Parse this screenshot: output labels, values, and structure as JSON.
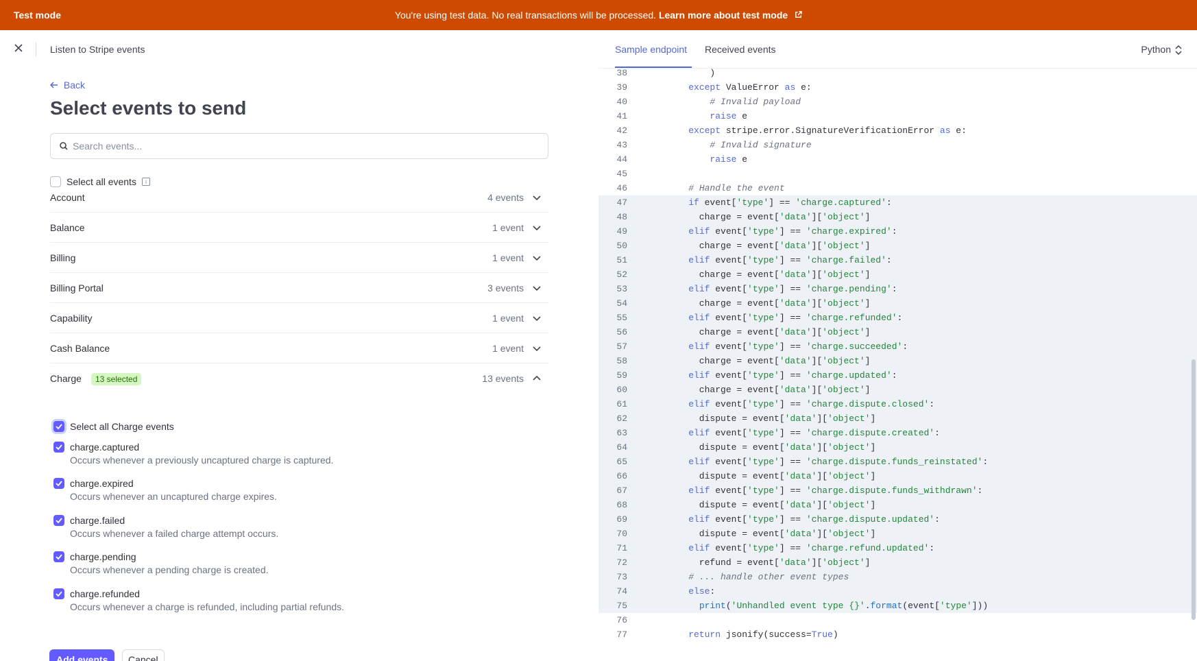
{
  "banner": {
    "mode": "Test mode",
    "message": "You're using test data. No real transactions will be processed.",
    "link": "Learn more about test mode"
  },
  "panel": {
    "title": "Listen to Stripe events",
    "back": "Back",
    "heading": "Select events to send",
    "search_placeholder": "Search events...",
    "select_all": "Select all events"
  },
  "categories": [
    {
      "name": "Account",
      "count": "4 events"
    },
    {
      "name": "Balance",
      "count": "1 event"
    },
    {
      "name": "Billing",
      "count": "1 event"
    },
    {
      "name": "Billing Portal",
      "count": "3 events"
    },
    {
      "name": "Capability",
      "count": "1 event"
    },
    {
      "name": "Cash Balance",
      "count": "1 event"
    },
    {
      "name": "Charge",
      "count": "13 events",
      "badge": "13 selected"
    }
  ],
  "charge": {
    "select_all": "Select all Charge events",
    "events": [
      {
        "name": "charge.captured",
        "desc": "Occurs whenever a previously uncaptured charge is captured."
      },
      {
        "name": "charge.expired",
        "desc": "Occurs whenever an uncaptured charge expires."
      },
      {
        "name": "charge.failed",
        "desc": "Occurs whenever a failed charge attempt occurs."
      },
      {
        "name": "charge.pending",
        "desc": "Occurs whenever a pending charge is created."
      },
      {
        "name": "charge.refunded",
        "desc": "Occurs whenever a charge is refunded, including partial refunds."
      }
    ]
  },
  "buttons": {
    "add": "Add events",
    "cancel": "Cancel"
  },
  "right": {
    "tabs": [
      "Sample endpoint",
      "Received events"
    ],
    "language": "Python"
  },
  "code": [
    {
      "n": "38",
      "t": [
        [
          "",
          "        )"
        ]
      ]
    },
    {
      "n": "39",
      "t": [
        [
          "",
          "    "
        ],
        [
          "kw",
          "except"
        ],
        [
          "",
          " ValueError "
        ],
        [
          "kw",
          "as"
        ],
        [
          "",
          " e:"
        ]
      ]
    },
    {
      "n": "40",
      "t": [
        [
          "",
          "        "
        ],
        [
          "cm",
          "# Invalid payload"
        ]
      ]
    },
    {
      "n": "41",
      "t": [
        [
          "",
          "        "
        ],
        [
          "kw",
          "raise"
        ],
        [
          "",
          " e"
        ]
      ]
    },
    {
      "n": "42",
      "t": [
        [
          "",
          "    "
        ],
        [
          "kw",
          "except"
        ],
        [
          "",
          " stripe.error.SignatureVerificationError "
        ],
        [
          "kw",
          "as"
        ],
        [
          "",
          " e:"
        ]
      ]
    },
    {
      "n": "43",
      "t": [
        [
          "",
          "        "
        ],
        [
          "cm",
          "# Invalid signature"
        ]
      ]
    },
    {
      "n": "44",
      "t": [
        [
          "",
          "        "
        ],
        [
          "kw",
          "raise"
        ],
        [
          "",
          " e"
        ]
      ]
    },
    {
      "n": "45",
      "t": [
        [
          "",
          ""
        ]
      ]
    },
    {
      "n": "46",
      "t": [
        [
          "",
          "    "
        ],
        [
          "cm",
          "# Handle the event"
        ]
      ]
    },
    {
      "n": "47",
      "t": [
        [
          "",
          "    "
        ],
        [
          "kw",
          "if"
        ],
        [
          "",
          " event["
        ],
        [
          "str",
          "'type'"
        ],
        [
          "",
          "] == "
        ],
        [
          "str",
          "'charge.captured'"
        ],
        [
          "",
          ":"
        ]
      ]
    },
    {
      "n": "48",
      "t": [
        [
          "",
          "      charge = event["
        ],
        [
          "str",
          "'data'"
        ],
        [
          "",
          "]["
        ],
        [
          "str",
          "'object'"
        ],
        [
          "",
          "]"
        ]
      ]
    },
    {
      "n": "49",
      "t": [
        [
          "",
          "    "
        ],
        [
          "kw",
          "elif"
        ],
        [
          "",
          " event["
        ],
        [
          "str",
          "'type'"
        ],
        [
          "",
          "] == "
        ],
        [
          "str",
          "'charge.expired'"
        ],
        [
          "",
          ":"
        ]
      ]
    },
    {
      "n": "50",
      "t": [
        [
          "",
          "      charge = event["
        ],
        [
          "str",
          "'data'"
        ],
        [
          "",
          "]["
        ],
        [
          "str",
          "'object'"
        ],
        [
          "",
          "]"
        ]
      ]
    },
    {
      "n": "51",
      "t": [
        [
          "",
          "    "
        ],
        [
          "kw",
          "elif"
        ],
        [
          "",
          " event["
        ],
        [
          "str",
          "'type'"
        ],
        [
          "",
          "] == "
        ],
        [
          "str",
          "'charge.failed'"
        ],
        [
          "",
          ":"
        ]
      ]
    },
    {
      "n": "52",
      "t": [
        [
          "",
          "      charge = event["
        ],
        [
          "str",
          "'data'"
        ],
        [
          "",
          "]["
        ],
        [
          "str",
          "'object'"
        ],
        [
          "",
          "]"
        ]
      ]
    },
    {
      "n": "53",
      "t": [
        [
          "",
          "    "
        ],
        [
          "kw",
          "elif"
        ],
        [
          "",
          " event["
        ],
        [
          "str",
          "'type'"
        ],
        [
          "",
          "] == "
        ],
        [
          "str",
          "'charge.pending'"
        ],
        [
          "",
          ":"
        ]
      ]
    },
    {
      "n": "54",
      "t": [
        [
          "",
          "      charge = event["
        ],
        [
          "str",
          "'data'"
        ],
        [
          "",
          "]["
        ],
        [
          "str",
          "'object'"
        ],
        [
          "",
          "]"
        ]
      ]
    },
    {
      "n": "55",
      "t": [
        [
          "",
          "    "
        ],
        [
          "kw",
          "elif"
        ],
        [
          "",
          " event["
        ],
        [
          "str",
          "'type'"
        ],
        [
          "",
          "] == "
        ],
        [
          "str",
          "'charge.refunded'"
        ],
        [
          "",
          ":"
        ]
      ]
    },
    {
      "n": "56",
      "t": [
        [
          "",
          "      charge = event["
        ],
        [
          "str",
          "'data'"
        ],
        [
          "",
          "]["
        ],
        [
          "str",
          "'object'"
        ],
        [
          "",
          "]"
        ]
      ]
    },
    {
      "n": "57",
      "t": [
        [
          "",
          "    "
        ],
        [
          "kw",
          "elif"
        ],
        [
          "",
          " event["
        ],
        [
          "str",
          "'type'"
        ],
        [
          "",
          "] == "
        ],
        [
          "str",
          "'charge.succeeded'"
        ],
        [
          "",
          ":"
        ]
      ]
    },
    {
      "n": "58",
      "t": [
        [
          "",
          "      charge = event["
        ],
        [
          "str",
          "'data'"
        ],
        [
          "",
          "]["
        ],
        [
          "str",
          "'object'"
        ],
        [
          "",
          "]"
        ]
      ]
    },
    {
      "n": "59",
      "t": [
        [
          "",
          "    "
        ],
        [
          "kw",
          "elif"
        ],
        [
          "",
          " event["
        ],
        [
          "str",
          "'type'"
        ],
        [
          "",
          "] == "
        ],
        [
          "str",
          "'charge.updated'"
        ],
        [
          "",
          ":"
        ]
      ]
    },
    {
      "n": "60",
      "t": [
        [
          "",
          "      charge = event["
        ],
        [
          "str",
          "'data'"
        ],
        [
          "",
          "]["
        ],
        [
          "str",
          "'object'"
        ],
        [
          "",
          "]"
        ]
      ]
    },
    {
      "n": "61",
      "t": [
        [
          "",
          "    "
        ],
        [
          "kw",
          "elif"
        ],
        [
          "",
          " event["
        ],
        [
          "str",
          "'type'"
        ],
        [
          "",
          "] == "
        ],
        [
          "str",
          "'charge.dispute.closed'"
        ],
        [
          "",
          ":"
        ]
      ]
    },
    {
      "n": "62",
      "t": [
        [
          "",
          "      dispute = event["
        ],
        [
          "str",
          "'data'"
        ],
        [
          "",
          "]["
        ],
        [
          "str",
          "'object'"
        ],
        [
          "",
          "]"
        ]
      ]
    },
    {
      "n": "63",
      "t": [
        [
          "",
          "    "
        ],
        [
          "kw",
          "elif"
        ],
        [
          "",
          " event["
        ],
        [
          "str",
          "'type'"
        ],
        [
          "",
          "] == "
        ],
        [
          "str",
          "'charge.dispute.created'"
        ],
        [
          "",
          ":"
        ]
      ]
    },
    {
      "n": "64",
      "t": [
        [
          "",
          "      dispute = event["
        ],
        [
          "str",
          "'data'"
        ],
        [
          "",
          "]["
        ],
        [
          "str",
          "'object'"
        ],
        [
          "",
          "]"
        ]
      ]
    },
    {
      "n": "65",
      "t": [
        [
          "",
          "    "
        ],
        [
          "kw",
          "elif"
        ],
        [
          "",
          " event["
        ],
        [
          "str",
          "'type'"
        ],
        [
          "",
          "] == "
        ],
        [
          "str",
          "'charge.dispute.funds_reinstated'"
        ],
        [
          "",
          ":"
        ]
      ]
    },
    {
      "n": "66",
      "t": [
        [
          "",
          "      dispute = event["
        ],
        [
          "str",
          "'data'"
        ],
        [
          "",
          "]["
        ],
        [
          "str",
          "'object'"
        ],
        [
          "",
          "]"
        ]
      ]
    },
    {
      "n": "67",
      "t": [
        [
          "",
          "    "
        ],
        [
          "kw",
          "elif"
        ],
        [
          "",
          " event["
        ],
        [
          "str",
          "'type'"
        ],
        [
          "",
          "] == "
        ],
        [
          "str",
          "'charge.dispute.funds_withdrawn'"
        ],
        [
          "",
          ":"
        ]
      ]
    },
    {
      "n": "68",
      "t": [
        [
          "",
          "      dispute = event["
        ],
        [
          "str",
          "'data'"
        ],
        [
          "",
          "]["
        ],
        [
          "str",
          "'object'"
        ],
        [
          "",
          "]"
        ]
      ]
    },
    {
      "n": "69",
      "t": [
        [
          "",
          "    "
        ],
        [
          "kw",
          "elif"
        ],
        [
          "",
          " event["
        ],
        [
          "str",
          "'type'"
        ],
        [
          "",
          "] == "
        ],
        [
          "str",
          "'charge.dispute.updated'"
        ],
        [
          "",
          ":"
        ]
      ]
    },
    {
      "n": "70",
      "t": [
        [
          "",
          "      dispute = event["
        ],
        [
          "str",
          "'data'"
        ],
        [
          "",
          "]["
        ],
        [
          "str",
          "'object'"
        ],
        [
          "",
          "]"
        ]
      ]
    },
    {
      "n": "71",
      "t": [
        [
          "",
          "    "
        ],
        [
          "kw",
          "elif"
        ],
        [
          "",
          " event["
        ],
        [
          "str",
          "'type'"
        ],
        [
          "",
          "] == "
        ],
        [
          "str",
          "'charge.refund.updated'"
        ],
        [
          "",
          ":"
        ]
      ]
    },
    {
      "n": "72",
      "t": [
        [
          "",
          "      refund = event["
        ],
        [
          "str",
          "'data'"
        ],
        [
          "",
          "]["
        ],
        [
          "str",
          "'object'"
        ],
        [
          "",
          "]"
        ]
      ]
    },
    {
      "n": "73",
      "t": [
        [
          "",
          "    "
        ],
        [
          "cm",
          "# ... handle other event types"
        ]
      ]
    },
    {
      "n": "74",
      "t": [
        [
          "",
          "    "
        ],
        [
          "kw",
          "else"
        ],
        [
          "",
          ":"
        ]
      ]
    },
    {
      "n": "75",
      "t": [
        [
          "",
          "      "
        ],
        [
          "fn",
          "print"
        ],
        [
          "",
          "("
        ],
        [
          "str",
          "'Unhandled event type {}'"
        ],
        [
          "",
          "."
        ],
        [
          "fn",
          "format"
        ],
        [
          "",
          "(event["
        ],
        [
          "str",
          "'type'"
        ],
        [
          "",
          "]))"
        ]
      ]
    },
    {
      "n": "76",
      "t": [
        [
          "",
          ""
        ]
      ]
    },
    {
      "n": "77",
      "t": [
        [
          "",
          "    "
        ],
        [
          "kw",
          "return"
        ],
        [
          "",
          " jsonify(success="
        ],
        [
          "kw",
          "True"
        ],
        [
          "",
          ")"
        ]
      ]
    }
  ],
  "colors": {
    "banner": "#cc4b00",
    "accent": "#635bff",
    "link": "#5469d4",
    "badge_bg": "#d7f7c2",
    "badge_text": "#217005",
    "string": "#23853d"
  }
}
